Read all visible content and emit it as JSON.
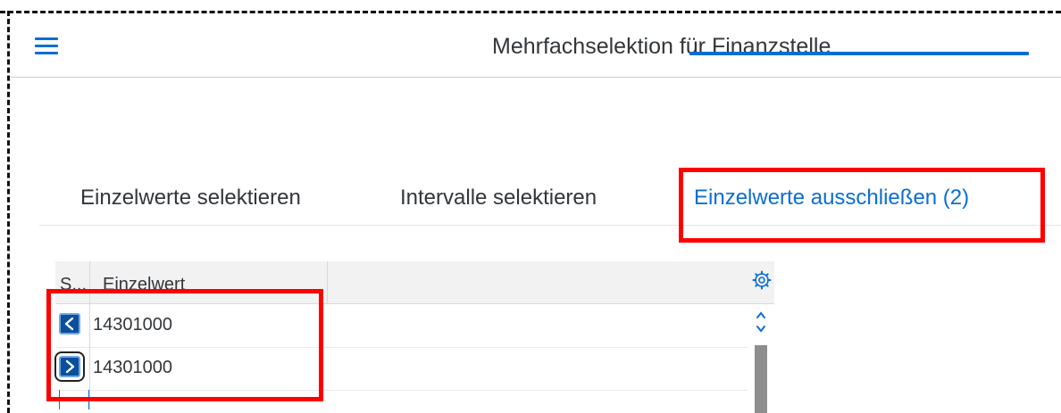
{
  "header": {
    "title": "Mehrfachselektion für Finanzstelle",
    "menu_icon": "hamburger-menu-icon"
  },
  "tabs": [
    {
      "label": "Einzelwerte selektieren",
      "active": false
    },
    {
      "label": "Intervalle selektieren",
      "active": false
    },
    {
      "label": "Einzelwerte ausschließen (2)",
      "active": true
    }
  ],
  "table": {
    "columns": {
      "select": "S...",
      "value": "Einzelwert"
    },
    "settings_icon": "settings-gear-icon",
    "rows": [
      {
        "button_icon": "chevron-left-icon",
        "button_glyph": "<",
        "value": "14301000"
      },
      {
        "button_icon": "chevron-right-icon",
        "button_glyph": ">",
        "value": "14301000"
      }
    ]
  },
  "colors": {
    "accent": "#0a6ed1",
    "highlight": "#ff0000",
    "button_bg": "#0a4f9c"
  }
}
